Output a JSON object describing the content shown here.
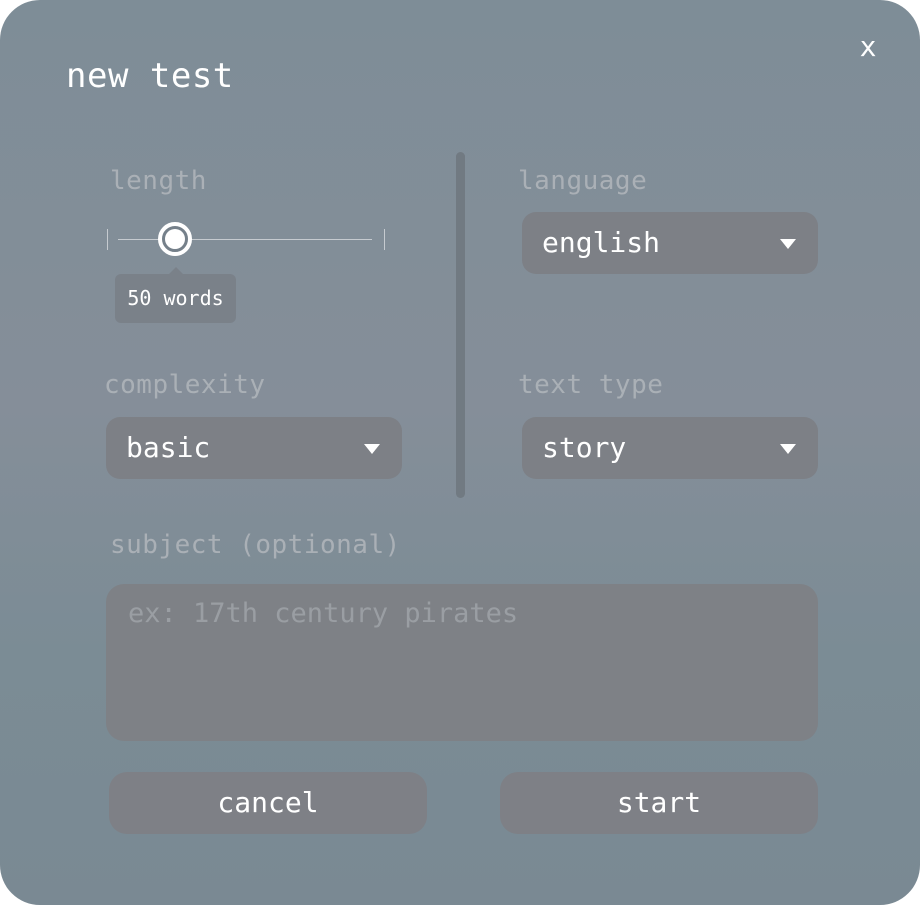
{
  "dialog": {
    "title": "new test",
    "close_label": "x"
  },
  "length": {
    "label": "length",
    "value_label": "50 words"
  },
  "language": {
    "label": "language",
    "selected": "english"
  },
  "complexity": {
    "label": "complexity",
    "selected": "basic"
  },
  "text_type": {
    "label": "text type",
    "selected": "story"
  },
  "subject": {
    "label": "subject (optional)",
    "placeholder": "ex: 17th century pirates",
    "value": ""
  },
  "actions": {
    "cancel_label": "cancel",
    "start_label": "start"
  }
}
